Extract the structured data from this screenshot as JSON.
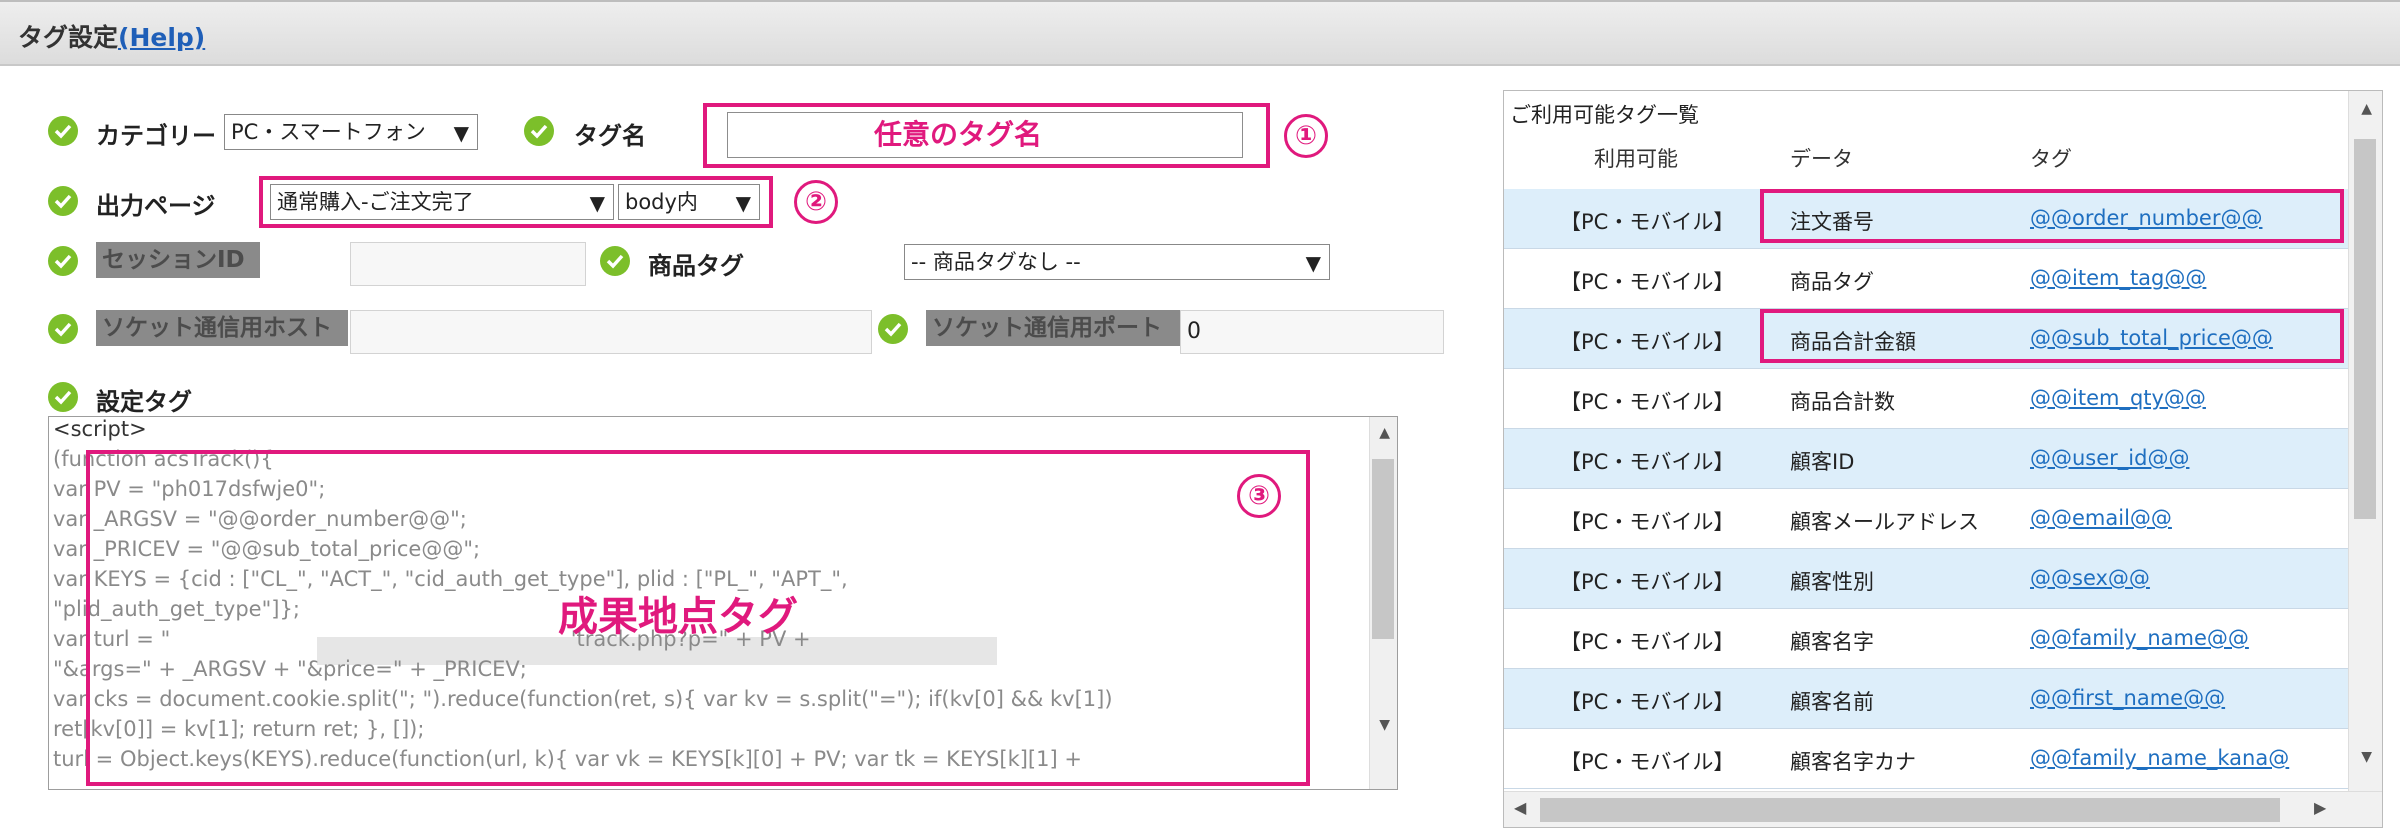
{
  "header": {
    "title": "タグ設定",
    "help": "(Help)"
  },
  "form": {
    "category_label": "カテゴリー",
    "category_value": "PC・スマートフォン",
    "tagname_label": "タグ名",
    "tagname_value": "任意のタグ名",
    "output_page_label": "出力ページ",
    "output_page_value": "通常購入-ご注文完了",
    "position_value": "body内",
    "session_label": "セッションID",
    "session_value": "",
    "product_tag_label": "商品タグ",
    "product_tag_value": "-- 商品タグなし --",
    "socket_host_label": "ソケット通信用ホスト",
    "socket_host_value": "",
    "socket_port_label": "ソケット通信用ポート",
    "socket_port_value": "0",
    "setting_tag_label": "設定タグ",
    "code_lines": [
      "<script>",
      "(function acsTrack(){",
      "var PV = \"ph017dsfwje0\";",
      "var _ARGSV = \"@@order_number@@\";",
      "var _PRICEV = \"@@sub_total_price@@\";",
      "var KEYS = {cid : [\"CL_\", \"ACT_\", \"cid_auth_get_type\"], plid : [\"PL_\", \"APT_\",",
      "\"plid_auth_get_type\"]};",
      "var turl = \"                                                            'track.php?p=\" + PV +",
      "\"&args=\" + _ARGSV + \"&price=\" + _PRICEV;",
      "var cks = document.cookie.split(\"; \").reduce(function(ret, s){ var kv = s.split(\"=\"); if(kv[0] && kv[1])",
      "ret[kv[0]] = kv[1]; return ret; }, []);",
      "turl = Object.keys(KEYS).reduce(function(url, k){ var vk = KEYS[k][0] + PV; var tk = KEYS[k][1] +"
    ]
  },
  "annotations": {
    "n1": "①",
    "n2": "②",
    "n3": "③",
    "conversion_tag": "成果地点タグ"
  },
  "tag_list": {
    "title": "ご利用可能タグ一覧",
    "headers": [
      "利用可能",
      "データ",
      "タグ"
    ],
    "rows": [
      {
        "avail": "【PC・モバイル】",
        "data": "注文番号",
        "tag": "@@order_number@@"
      },
      {
        "avail": "【PC・モバイル】",
        "data": "商品タグ",
        "tag": "@@item_tag@@"
      },
      {
        "avail": "【PC・モバイル】",
        "data": "商品合計金額",
        "tag": "@@sub_total_price@@"
      },
      {
        "avail": "【PC・モバイル】",
        "data": "商品合計数",
        "tag": "@@item_qty@@"
      },
      {
        "avail": "【PC・モバイル】",
        "data": "顧客ID",
        "tag": "@@user_id@@"
      },
      {
        "avail": "【PC・モバイル】",
        "data": "顧客メールアドレス",
        "tag": "@@email@@"
      },
      {
        "avail": "【PC・モバイル】",
        "data": "顧客性別",
        "tag": "@@sex@@"
      },
      {
        "avail": "【PC・モバイル】",
        "data": "顧客名字",
        "tag": "@@family_name@@"
      },
      {
        "avail": "【PC・モバイル】",
        "data": "顧客名前",
        "tag": "@@first_name@@"
      },
      {
        "avail": "【PC・モバイル】",
        "data": "顧客名字カナ",
        "tag": "@@family_name_kana@"
      }
    ]
  },
  "colors": {
    "highlight": "#e0197d",
    "check": "#7cbf2a",
    "link": "#1f6fc0",
    "row_alt": "#ddeefa"
  }
}
